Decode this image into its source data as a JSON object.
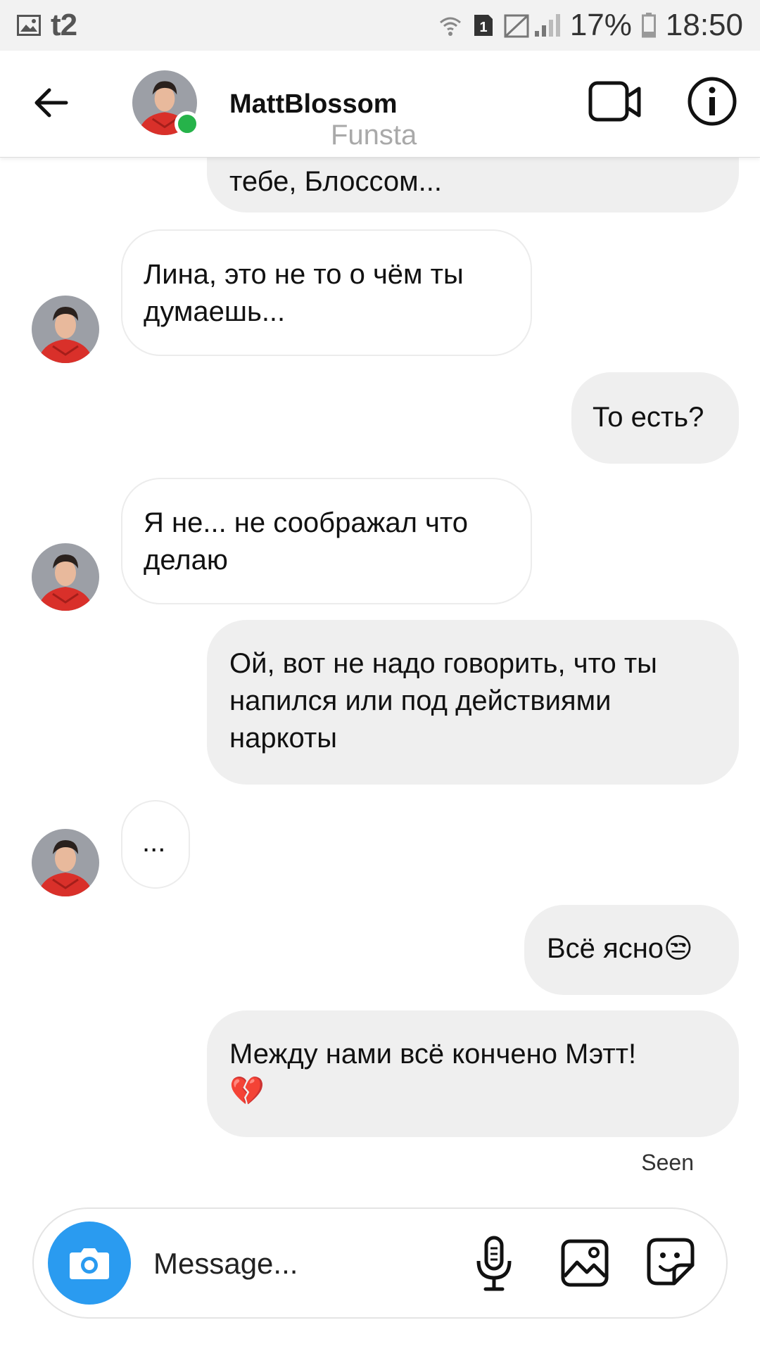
{
  "status_bar": {
    "carrier": "t2",
    "sim_slot": "1",
    "battery": "17%",
    "time": "18:50",
    "icons": [
      "image-icon",
      "wifi-icon",
      "sim-icon",
      "signal-icon",
      "battery-icon"
    ]
  },
  "header": {
    "username": "MattBlossom",
    "subtitle": "Funsta",
    "online_color": "#26b34a",
    "icons": [
      "back-arrow-icon",
      "video-call-icon",
      "info-icon"
    ]
  },
  "messages": [
    {
      "side": "out",
      "text": "тебе, Блоссом..."
    },
    {
      "side": "in",
      "lines": [
        "Лина, это не то о чём ты",
        "думаешь..."
      ]
    },
    {
      "side": "out",
      "text": "То есть?"
    },
    {
      "side": "in",
      "lines": [
        "Я не... не соображал что",
        "делаю"
      ]
    },
    {
      "side": "out",
      "lines": [
        "Ой, вот не надо говорить, что ты",
        "напился или под действиями",
        "наркоты"
      ]
    },
    {
      "side": "in",
      "text": "..."
    },
    {
      "side": "out",
      "text": "Всё ясно",
      "emoji": "😒"
    },
    {
      "side": "out",
      "text": "Между нами всё кончено Мэтт!",
      "emoji": "💔"
    }
  ],
  "seen_label": "Seen",
  "composer": {
    "placeholder": "Message...",
    "accent": "#2a9bf0",
    "icons": [
      "camera-icon",
      "microphone-icon",
      "gallery-icon",
      "sticker-icon"
    ]
  }
}
